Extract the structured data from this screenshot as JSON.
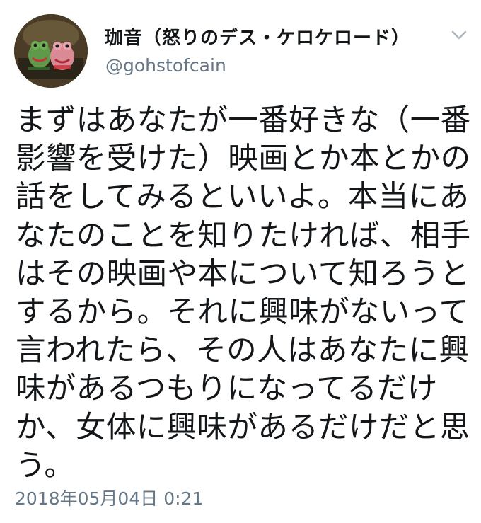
{
  "author": {
    "display_name": "珈音（怒りのデス・ケロケロード）",
    "handle": "@gohstofcain"
  },
  "tweet": {
    "lines": [
      "まずはあなたが一番好きな（一番",
      "影響を受けた）映画とか本とかの",
      "話をしてみるといいよ。本当にあ",
      "なたのことを知りたければ、相手",
      "はその映画や本について知ろうと",
      "するから。それに興味がないって",
      "言われたら、その人はあなたに興",
      "味があるつもりになってるだけ",
      "か、女体に興味があるだけだと思",
      "う。"
    ],
    "timestamp": "2018年05月04日 0:21"
  },
  "icons": {
    "menu_caret": "chevron-down-icon",
    "avatar": "avatar"
  },
  "colors": {
    "text_primary": "#14171a",
    "text_secondary": "#657786",
    "caret": "#aab8c2",
    "background": "#ffffff"
  }
}
